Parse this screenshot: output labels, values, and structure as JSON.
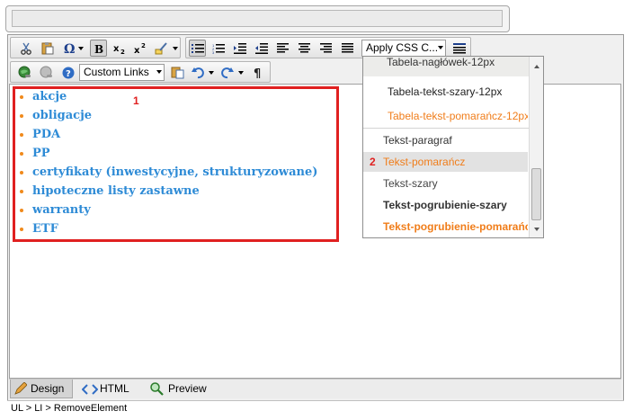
{
  "title_field": {
    "value": ""
  },
  "toolbar1": {
    "css_select_label": "Apply CSS C..."
  },
  "toolbar2": {
    "links_select_label": "Custom Links"
  },
  "content": {
    "list_items": [
      "akcje",
      "obligacje",
      "PDA",
      "PP",
      "certyfikaty (inwestycyjne, strukturyzowane)",
      "hipoteczne listy zastawne",
      "warranty",
      "ETF"
    ],
    "marker_1": "1"
  },
  "css_dropdown": {
    "marker_2": "2",
    "items": [
      {
        "label": "Tabela-nagłówek-12px",
        "color": "#333333"
      },
      {
        "label": "Tabela-tekst-szary-12px",
        "color": "#222222"
      },
      {
        "label": "Tabela-tekst-pomarańcz-12px",
        "color": "#f07d1a"
      },
      {
        "label": "Tekst-paragraf",
        "color": "#333333"
      },
      {
        "label": "Tekst-pomarańcz",
        "color": "#f07d1a"
      },
      {
        "label": "Tekst-szary",
        "color": "#444444"
      },
      {
        "label": "Tekst-pogrubienie-szary",
        "color": "#333333"
      },
      {
        "label": "Tekst-pogrubienie-pomarańcz",
        "color": "#f07d1a"
      }
    ]
  },
  "tabs": {
    "design": "Design",
    "html": "HTML",
    "preview": "Preview"
  },
  "status": {
    "path": "UL > LI > RemoveElement"
  },
  "colors": {
    "list_text": "#2e8bd6",
    "bullet": "#f08a1c",
    "highlight_border": "#e02020"
  }
}
